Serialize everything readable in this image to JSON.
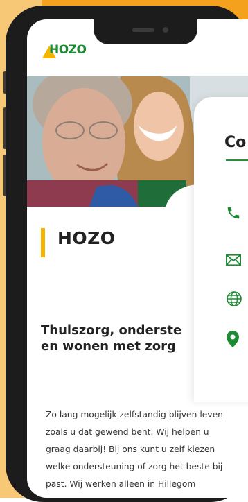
{
  "app": {
    "logo_text": "HOZO"
  },
  "main": {
    "heading": "HOZO",
    "subheading_lines": [
      "Thuiszorg, onderste",
      "en wonen met zorg"
    ],
    "body_lines": [
      "Zo lang mogelijk zelfstandig blijven leven",
      "zoals u dat gewend bent. Wij helpen u",
      "graag daarbij! Bij ons kunt u zelf kiezen",
      "welke ondersteuning of zorg het beste bij",
      "past. Wij werken alleen in Hillegom"
    ]
  },
  "contact_panel": {
    "title": "Co",
    "icons": [
      "phone-icon",
      "envelope-icon",
      "globe-icon",
      "location-pin-icon"
    ]
  },
  "colors": {
    "background_orange": "#f4a11d",
    "brand_green": "#1e8a34",
    "accent_yellow": "#f4b400"
  }
}
